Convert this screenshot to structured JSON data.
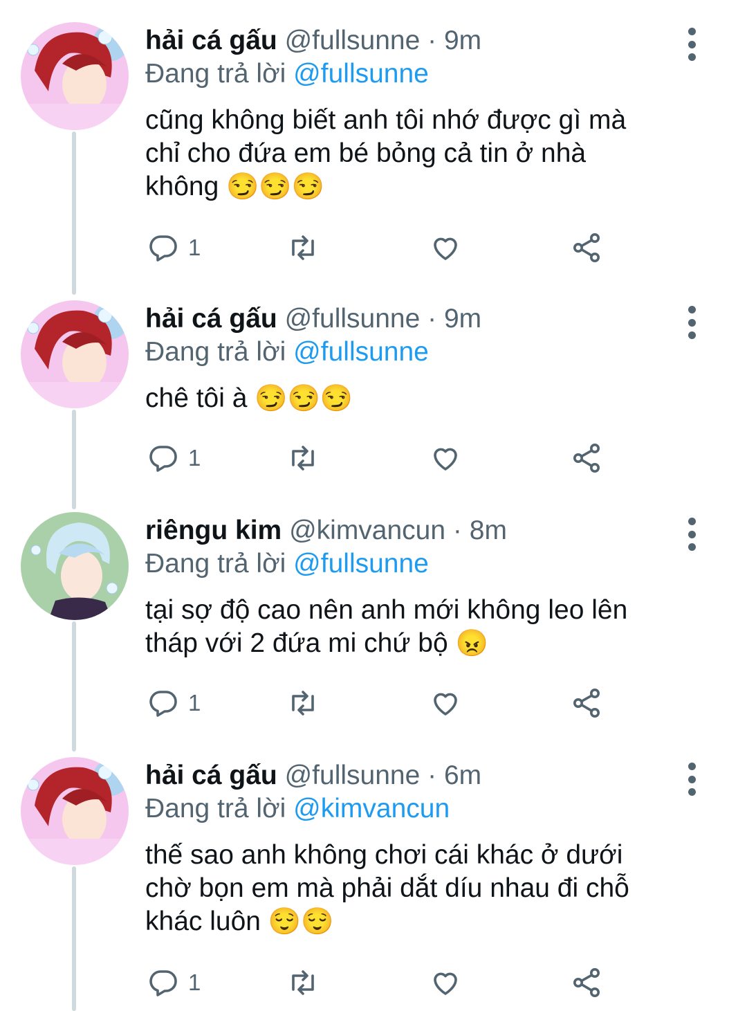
{
  "tweets": [
    {
      "name": "hải cá gấu",
      "handle": "@fullsunne",
      "time": "9m",
      "reply_prefix": "Đang trả lời",
      "reply_to": "@fullsunne",
      "lines": [
        "cũng không biết anh tôi nhớ được gì mà",
        "chỉ cho đứa em bé bỏng cả tin ở nhà",
        "không"
      ],
      "emojis": "😏😏😏",
      "reply_count": "1",
      "avatar": "red-hair-avatar"
    },
    {
      "name": "hải cá gấu",
      "handle": "@fullsunne",
      "time": "9m",
      "reply_prefix": "Đang trả lời",
      "reply_to": "@fullsunne",
      "lines": [
        "chê tôi à"
      ],
      "emojis": "😏😏😏",
      "reply_count": "1",
      "avatar": "red-hair-avatar"
    },
    {
      "name": "riêngu kim",
      "handle": "@kimvancun",
      "time": "8m",
      "reply_prefix": "Đang trả lời",
      "reply_to": "@fullsunne",
      "lines": [
        "tại sợ độ cao nên anh mới không leo lên",
        "tháp với 2 đứa mi chứ bộ"
      ],
      "emojis": "😠",
      "reply_count": "1",
      "avatar": "blue-hair-avatar"
    },
    {
      "name": "hải cá gấu",
      "handle": "@fullsunne",
      "time": "6m",
      "reply_prefix": "Đang trả lời",
      "reply_to": "@kimvancun",
      "lines": [
        "thế sao anh không chơi cái khác ở dưới",
        "chờ bọn em mà phải dắt díu nhau đi chỗ",
        "khác luôn"
      ],
      "emojis": "😌😌",
      "reply_count": "1",
      "avatar": "red-hair-avatar"
    }
  ],
  "colors": {
    "text": "#0f1419",
    "secondary": "#536471",
    "link": "#1d9bf0",
    "thread_line": "#cfd9de"
  },
  "icons": [
    "reply-icon",
    "retweet-icon",
    "like-icon",
    "share-icon",
    "more-icon"
  ]
}
